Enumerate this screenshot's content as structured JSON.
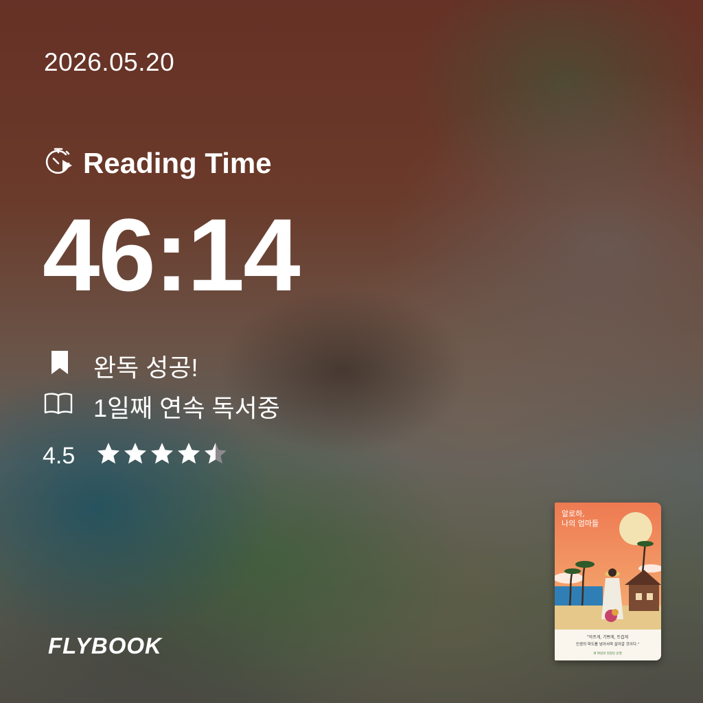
{
  "date": "2026.05.20",
  "reading": {
    "icon": "stopwatch-play-icon",
    "label": "Reading Time",
    "time": "46:14"
  },
  "status": {
    "bookmark_icon": "bookmark-icon",
    "finish_text": "완독 성공!",
    "book_icon": "open-book-icon",
    "streak_text": "1일째 연속 독서중"
  },
  "rating": {
    "value_text": "4.5",
    "value": 4.5,
    "max": 5,
    "star_color": "#ffffff",
    "empty_color": "#8f8a8e"
  },
  "brand": {
    "logo": "FLYBOOK"
  },
  "book": {
    "title_line1": "알로하,",
    "title_line2": "나의 엄마들",
    "quote_line1": "\"아프게, 기쁘게, 뜨겁게",
    "quote_line2": "인생의 파도를 넘어서며 살아갈 것이다.\"",
    "tagline": "세 여성의 엇갈린 운명"
  },
  "colors": {
    "text": "#ffffff",
    "cover_sky": "#f0845a",
    "cover_sun": "#f3e3b2"
  }
}
